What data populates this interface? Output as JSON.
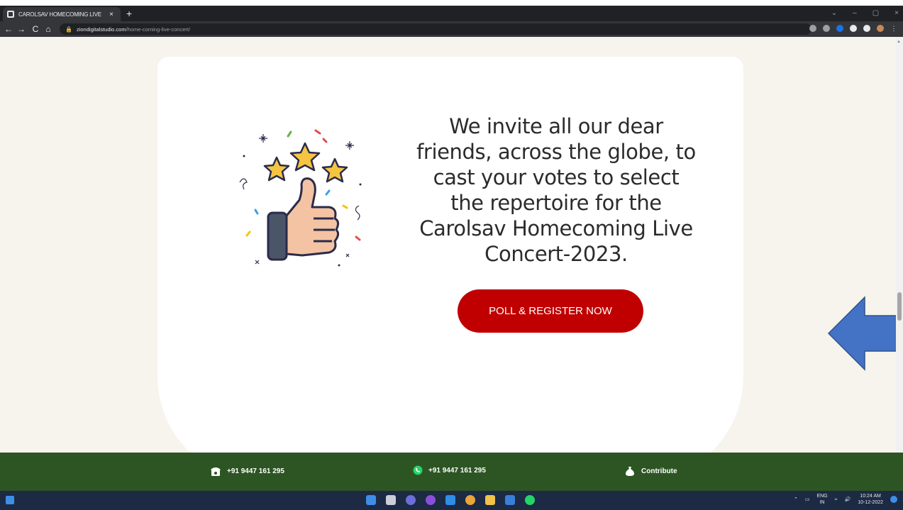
{
  "browser": {
    "tab_title": "CAROLSAV HOMECOMING LIVE",
    "tab_close": "×",
    "new_tab": "+",
    "url_host": "ziondigitalstudio.com",
    "url_path": "/home-coming-live-concert/",
    "nav": {
      "back": "←",
      "forward": "→",
      "reload": "C",
      "home": "⌂"
    },
    "window_controls": {
      "minimize": "–",
      "maximize": "▢",
      "close": "×",
      "tab_search": "⌄"
    }
  },
  "content": {
    "invite_text": "We invite all our dear friends, across the globe, to cast your votes to select the repertoire for the Carolsav Homecoming Live Concert-2023.",
    "cta_label": "POLL & REGISTER NOW"
  },
  "footer": {
    "phone": "+91 9447 161 295",
    "whatsapp": "+91 9447 161 295",
    "contribute": "Contribute"
  },
  "taskbar": {
    "language": "ENG",
    "region": "IN",
    "time": "10:24 AM",
    "date": "10-12-2022"
  },
  "colors": {
    "cta": "#c00000",
    "footer": "#2c5523",
    "arrow": "#4472c4",
    "page_bg": "#f6f4ec"
  },
  "icons": {
    "illustration": "thumbs-up-stars-icon",
    "arrow": "left-arrow-icon",
    "phone": "telephone-icon",
    "whatsapp": "whatsapp-icon",
    "contribute": "money-bag-icon"
  }
}
